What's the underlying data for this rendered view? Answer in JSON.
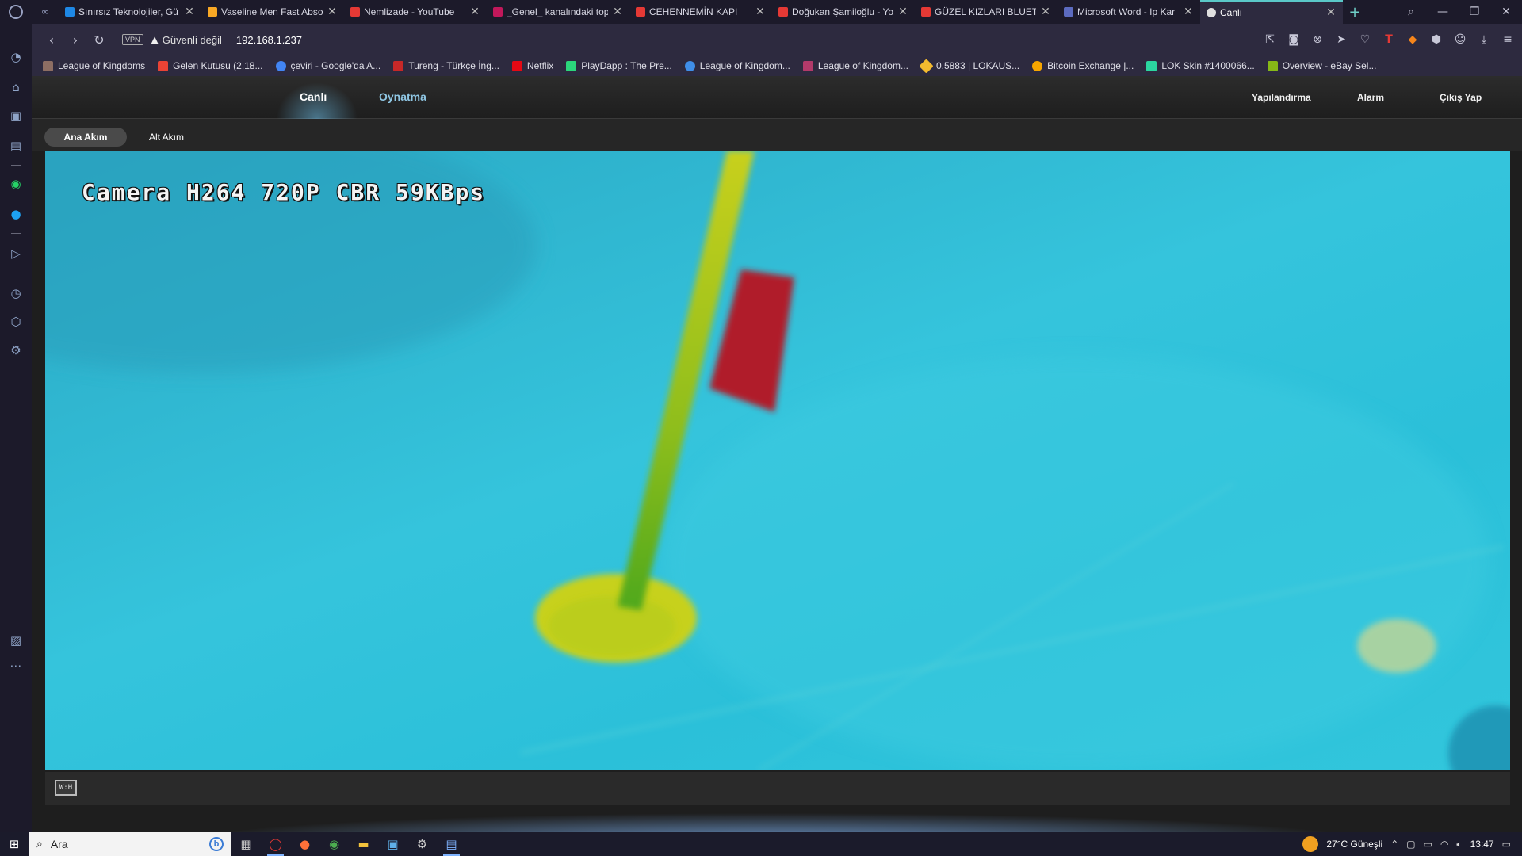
{
  "browser": {
    "tabs": [
      {
        "title": "Sınırsız Teknolojiler, Gü",
        "color": "#1e88e5"
      },
      {
        "title": "Vaseline Men Fast Abso",
        "color": "#f9a825"
      },
      {
        "title": "Nemlizade - YouTube",
        "color": "#e53935"
      },
      {
        "title": "_Genel_ kanalındaki top",
        "color": "#c2185b"
      },
      {
        "title": "CEHENNEMİN KAPI",
        "color": "#e53935"
      },
      {
        "title": "Doğukan Şamiloğlu - Yo",
        "color": "#e53935"
      },
      {
        "title": "GÜZEL KIZLARI BLUETO",
        "color": "#e53935"
      },
      {
        "title": "Microsoft Word - Ip Kar",
        "color": "#5c6bc0"
      },
      {
        "title": "Canlı",
        "color": "#e0e0e0",
        "active": true
      }
    ],
    "new_tab": "+",
    "address": {
      "vpn": "VPN",
      "security": "Güvenli değil",
      "url": "192.168.1.237"
    },
    "bookmarks": [
      {
        "label": "League of Kingdoms",
        "color": "#8d6e63"
      },
      {
        "label": "Gelen Kutusu (2.18...",
        "color": "#ea4335"
      },
      {
        "label": "çeviri - Google'da A...",
        "color": "#4285f4"
      },
      {
        "label": "Tureng - Türkçe İng...",
        "color": "#c62828"
      },
      {
        "label": "Netflix",
        "color": "#e50914"
      },
      {
        "label": "PlayDapp : The Pre...",
        "color": "#2bd67b"
      },
      {
        "label": "League of Kingdom...",
        "color": "#3f8ee8"
      },
      {
        "label": "League of Kingdom...",
        "color": "#b23a6a"
      },
      {
        "label": "0.5883 | LOKAUS...",
        "color": "#f3ba2f"
      },
      {
        "label": "Bitcoin Exchange |...",
        "color": "#f7a600"
      },
      {
        "label": "LOK Skin #1400066...",
        "color": "#2bd6a0"
      },
      {
        "label": "Overview - eBay Sel...",
        "color": "#86b817"
      }
    ]
  },
  "camera_ui": {
    "nav": {
      "live": "Canlı",
      "playback": "Oynatma",
      "config": "Yapılandırma",
      "alarm": "Alarm",
      "logout": "Çıkış Yap"
    },
    "streams": {
      "main": "Ana Akım",
      "sub": "Alt Akım"
    },
    "osd_text": "Camera H264 720P CBR 59KBps",
    "fit_button": "W:H"
  },
  "taskbar": {
    "search_placeholder": "Ara",
    "bing": "b",
    "weather": "27°C  Güneşli",
    "time": "13:47"
  }
}
